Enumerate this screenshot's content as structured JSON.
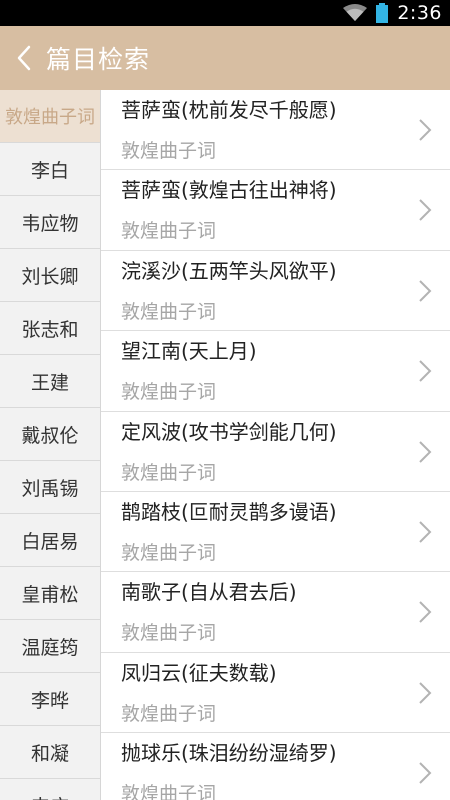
{
  "status": {
    "time": "2:36"
  },
  "header": {
    "title": "篇目检索"
  },
  "colors": {
    "header_bg": "#d7bea2",
    "active_text": "#c8a888"
  },
  "sidebar": {
    "items": [
      {
        "label": "敦煌曲子词",
        "active": true
      },
      {
        "label": "李白"
      },
      {
        "label": "韦应物"
      },
      {
        "label": "刘长卿"
      },
      {
        "label": "张志和"
      },
      {
        "label": "王建"
      },
      {
        "label": "戴叔伦"
      },
      {
        "label": "刘禹锡"
      },
      {
        "label": "白居易"
      },
      {
        "label": "皇甫松"
      },
      {
        "label": "温庭筠"
      },
      {
        "label": "李晔"
      },
      {
        "label": "和凝"
      },
      {
        "label": "韦庄"
      }
    ]
  },
  "list": {
    "items": [
      {
        "title": "菩萨蛮(枕前发尽千般愿)",
        "subtitle": "敦煌曲子词"
      },
      {
        "title": "菩萨蛮(敦煌古往出神将)",
        "subtitle": "敦煌曲子词"
      },
      {
        "title": "浣溪沙(五两竿头风欲平)",
        "subtitle": "敦煌曲子词"
      },
      {
        "title": "望江南(天上月)",
        "subtitle": "敦煌曲子词"
      },
      {
        "title": "定风波(攻书学剑能几何)",
        "subtitle": "敦煌曲子词"
      },
      {
        "title": "鹊踏枝(叵耐灵鹊多谩语)",
        "subtitle": "敦煌曲子词"
      },
      {
        "title": "南歌子(自从君去后)",
        "subtitle": "敦煌曲子词"
      },
      {
        "title": "凤归云(征夫数载)",
        "subtitle": "敦煌曲子词"
      },
      {
        "title": "抛球乐(珠泪纷纷湿绮罗)",
        "subtitle": "敦煌曲子词"
      }
    ]
  }
}
